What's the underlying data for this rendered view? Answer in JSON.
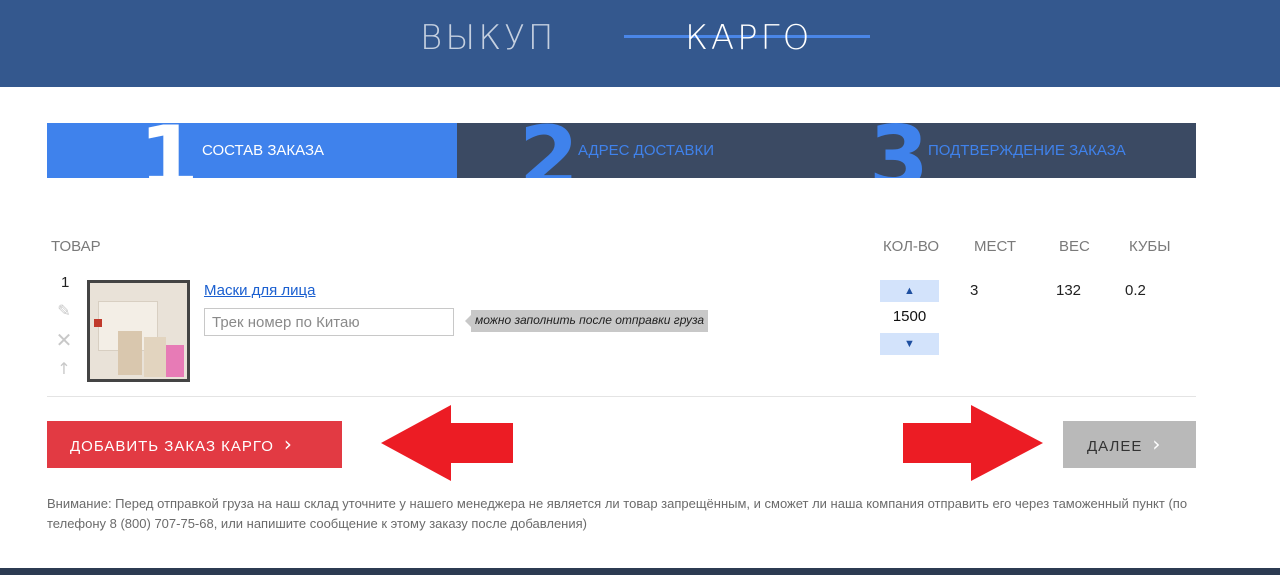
{
  "header": {
    "nav_vykup": "ВЫКУП",
    "nav_kargo": "КАРГО"
  },
  "steps": [
    {
      "number": "1",
      "label": "СОСТАВ ЗАКАЗА"
    },
    {
      "number": "2",
      "label": "АДРЕС ДОСТАВКИ"
    },
    {
      "number": "3",
      "label": "ПОДТВЕРЖДЕНИЕ ЗАКАЗА"
    }
  ],
  "table": {
    "headers": {
      "product": "ТОВАР",
      "qty": "КОЛ-ВО",
      "places": "МЕСТ",
      "weight": "ВЕС",
      "volume": "КУБЫ"
    },
    "row": {
      "index": "1",
      "product_name": "Маски для лица",
      "track_placeholder": "Трек номер по Китаю",
      "track_value": "",
      "hint": "можно заполнить после отправки груза",
      "qty": "1500",
      "qty_up": "▲",
      "qty_down": "▼",
      "places": "3",
      "weight": "132",
      "volume": "0.2"
    }
  },
  "actions": {
    "add_cargo": "ДОБАВИТЬ ЗАКАЗ КАРГО",
    "next": "ДАЛЕЕ",
    "chevron": "›"
  },
  "notice": "Внимание: Перед отправкой груза на наш склад уточните у нашего менеджера не является ли товар запрещённым, и сможет ли наша компания отправить его через таможенный пункт (по телефону 8 (800) 707-75-68, или напишите сообщение к этому заказу после добавления)",
  "colors": {
    "header_bg": "#34588e",
    "accent_blue": "#3f82ec",
    "step_inactive_bg": "#3b4a63",
    "add_button": "#e23a43",
    "next_button": "#b9b9b9",
    "annotation_arrow": "#ec1c24"
  },
  "icons": {
    "row_edit": "pencil-icon",
    "row_delete": "close-icon",
    "row_move_up": "arrow-up-icon"
  }
}
